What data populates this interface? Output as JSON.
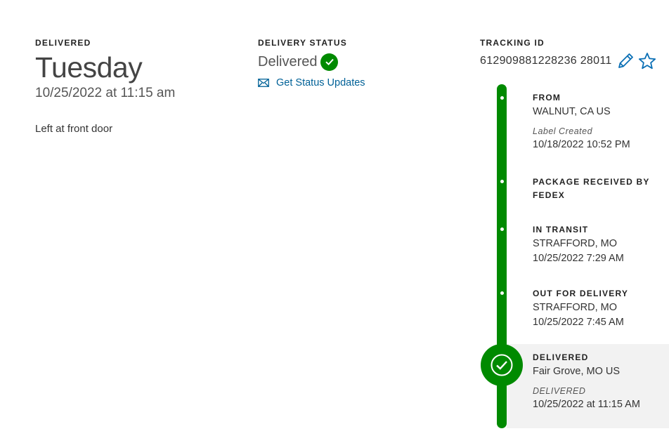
{
  "delivered": {
    "label": "DELIVERED",
    "day": "Tuesday",
    "datetime": "10/25/2022 at 11:15 am",
    "note": "Left at front door"
  },
  "status": {
    "label": "DELIVERY STATUS",
    "value": "Delivered",
    "updates_link": "Get Status Updates"
  },
  "tracking": {
    "label": "TRACKING ID",
    "number": "612909881228236 28011"
  },
  "timeline": {
    "events": [
      {
        "title": "FROM",
        "location": "WALNUT, CA US",
        "sub": "Label Created",
        "datetime": "10/18/2022 10:52 PM"
      },
      {
        "title": "PACKAGE RECEIVED BY FEDEX"
      },
      {
        "title": "IN TRANSIT",
        "location": "STRAFFORD, MO",
        "datetime": "10/25/2022 7:29 AM"
      },
      {
        "title": "OUT FOR DELIVERY",
        "location": "STRAFFORD, MO",
        "datetime": "10/25/2022 7:45 AM"
      },
      {
        "title": "DELIVERED",
        "location": "Fair Grove, MO US",
        "sub": "DELIVERED",
        "datetime": "10/25/2022 at 11:15 AM"
      }
    ]
  },
  "colors": {
    "success_green": "#008a00",
    "link_blue": "#006197",
    "icon_blue": "#0a6fb5",
    "highlight_bg": "#f2f2f2"
  },
  "icons": {
    "status": "check-circle-icon",
    "updates": "envelope-icon",
    "edit": "pencil-icon",
    "favorite": "star-icon",
    "final_step": "check-circle-icon"
  }
}
